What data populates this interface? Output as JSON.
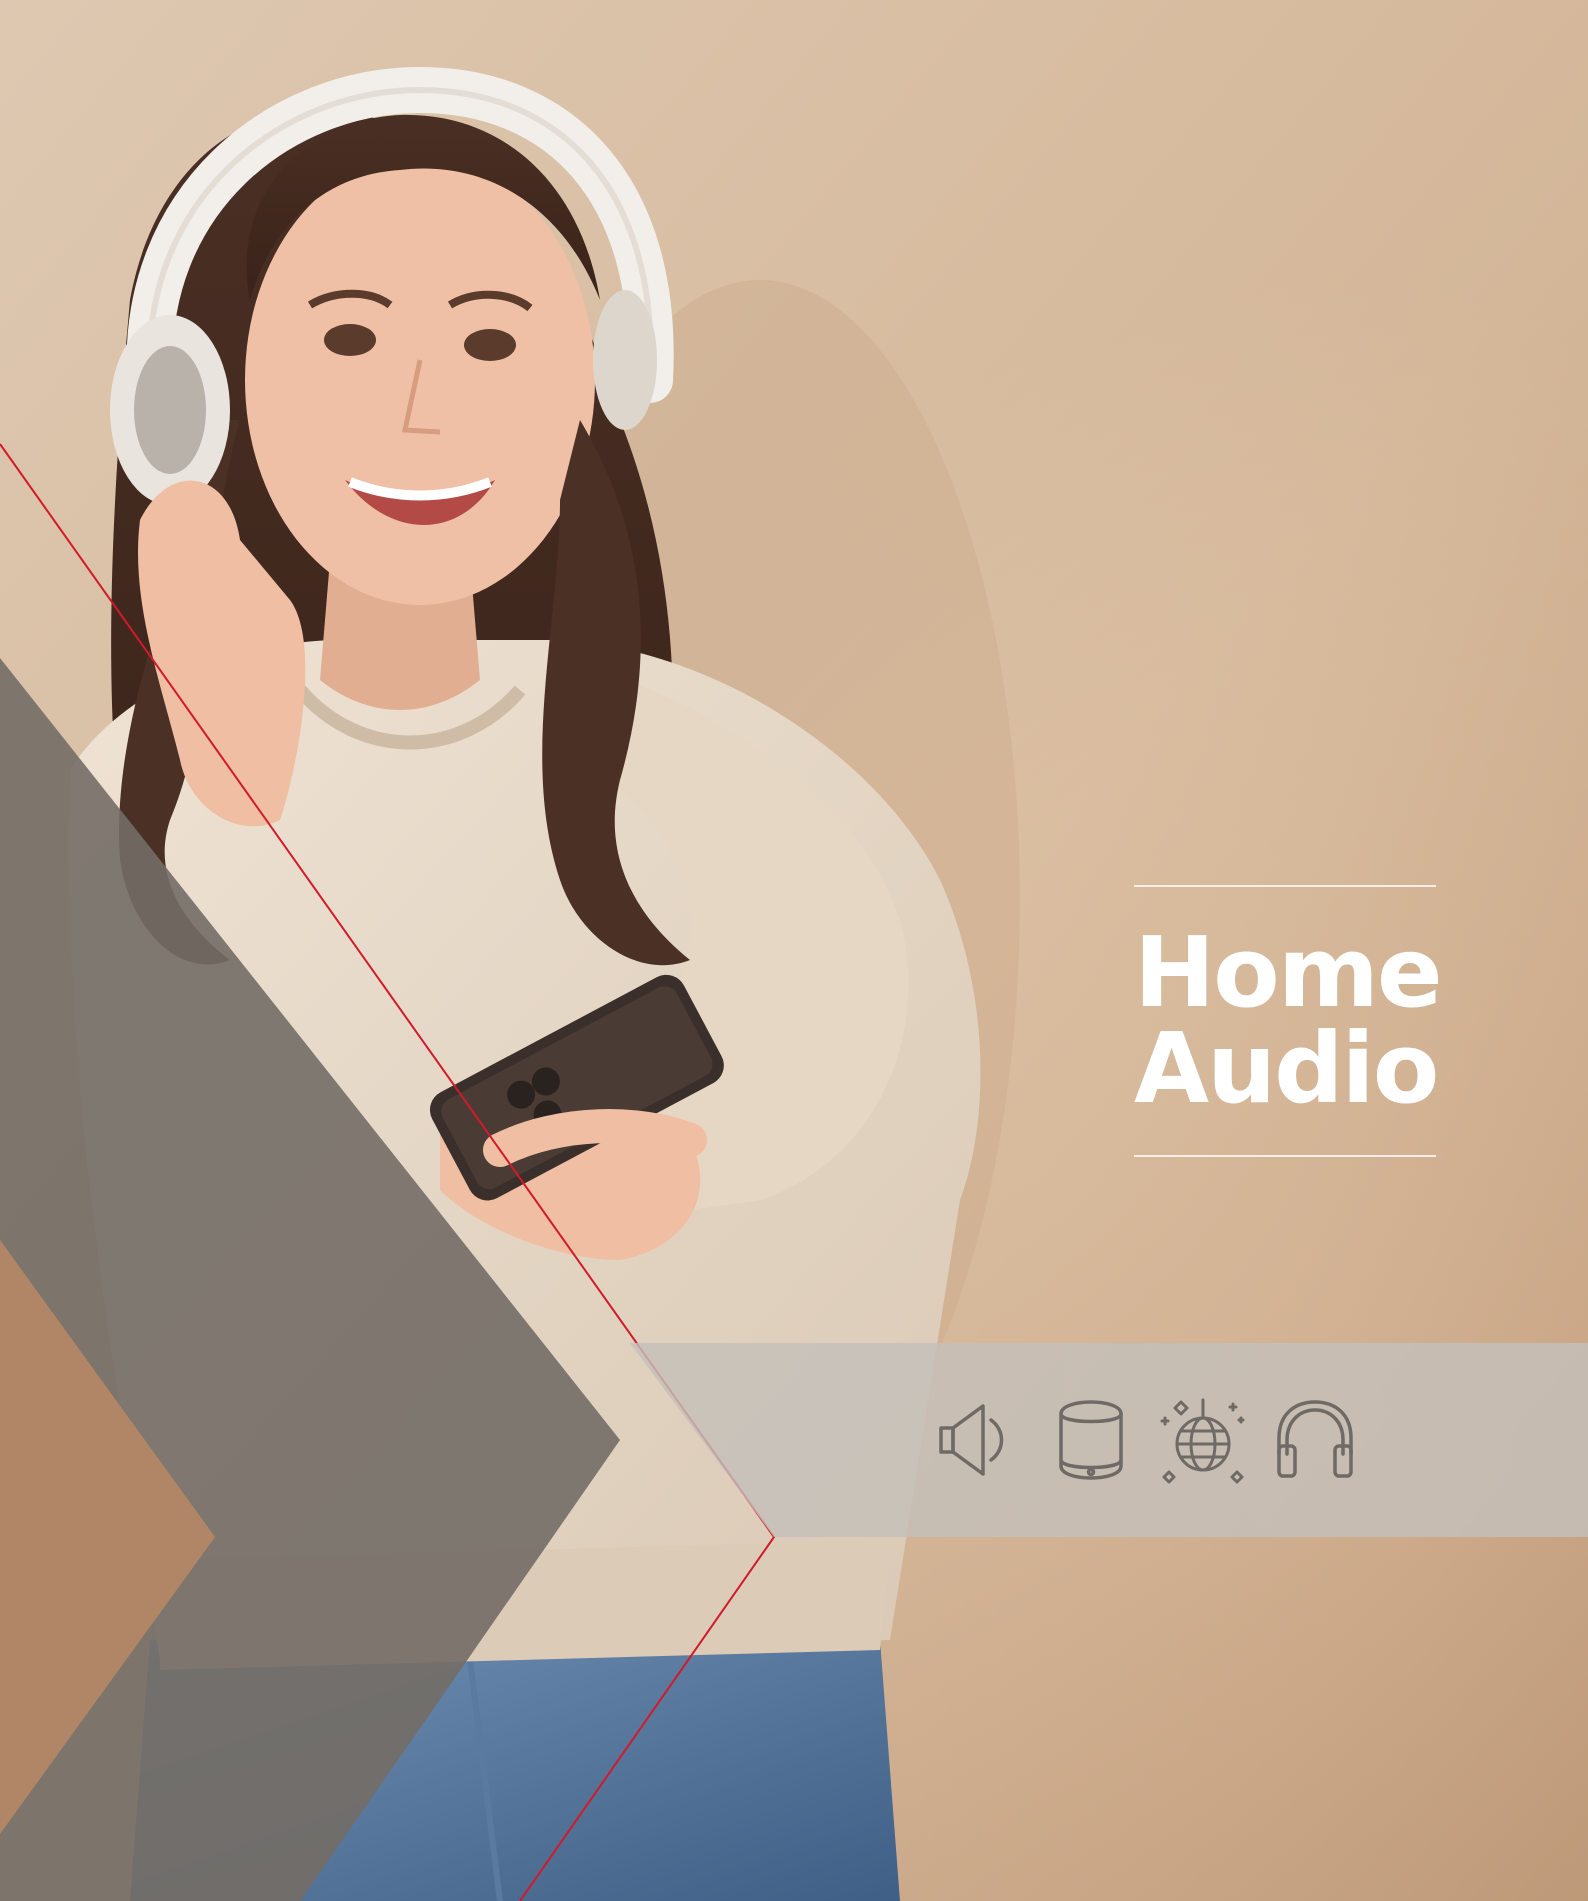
{
  "title": {
    "line1": "Home",
    "line2": "Audio"
  },
  "colors": {
    "background_light": "#efdcc7",
    "background_mid": "#dcc0a2",
    "background_dark": "#b99473",
    "gray_chevron": "#736d66",
    "tan_chevron": "#b08666",
    "accent_line": "#d11a2a",
    "band": "#c4c0ba",
    "icon_stroke": "#6f6a66",
    "title_text": "#ffffff",
    "rule": "#f7efe6"
  },
  "icons": [
    {
      "name": "speaker-icon"
    },
    {
      "name": "smart-speaker-icon"
    },
    {
      "name": "disco-ball-icon"
    },
    {
      "name": "headphones-icon"
    }
  ]
}
